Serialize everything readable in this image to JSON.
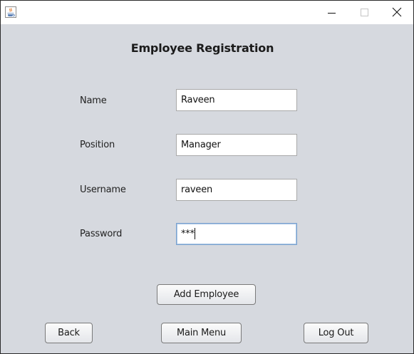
{
  "window": {
    "controls": {
      "minimize_icon": "minimize-icon",
      "maximize_icon": "maximize-icon",
      "close_icon": "close-icon"
    },
    "app_icon": "java-coffee-cup-icon"
  },
  "form": {
    "title": "Employee Registration",
    "fields": [
      {
        "label": "Name",
        "value": "Raveen"
      },
      {
        "label": "Position",
        "value": "Manager"
      },
      {
        "label": "Username",
        "value": "raveen"
      },
      {
        "label": "Password",
        "value": "***"
      }
    ],
    "add_button": "Add Employee"
  },
  "footer": {
    "back": "Back",
    "main_menu": "Main Menu",
    "log_out": "Log Out"
  },
  "colors": {
    "background": "#d6d9df",
    "focus_border": "#7aa2cf"
  }
}
